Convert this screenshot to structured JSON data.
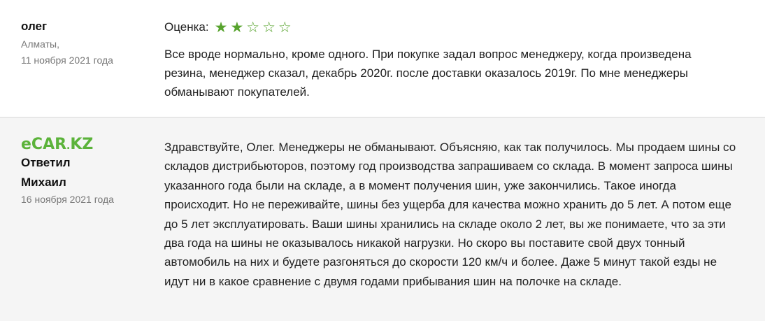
{
  "review": {
    "author": "олег",
    "city": "Алматы,",
    "date": "11 ноября 2021 года",
    "rating_label": "Оценка:",
    "rating": 2,
    "rating_max": 5,
    "star_filled_icon": "star-filled-icon",
    "star_empty_icon": "star-outline-icon",
    "text": "Все вроде нормально, кроме одного. При покупке задал вопрос менеджеру, когда произведена резина, менеджер сказал, декабрь 2020г. после доставки оказалось 2019г. По мне менеджеры обманывают покупателей."
  },
  "reply": {
    "logo_text_main": "eCAR",
    "logo_text_dot": ".",
    "logo_text_tld": "KZ",
    "label": "Ответил",
    "manager": "Михаил",
    "date": "16 ноября 2021 года",
    "text": "Здравствуйте, Олег. Менеджеры не обманывают. Объясняю, как так получилось. Мы продаем шины со складов дистрибьюторов, поэтому год производства запрашиваем со склада. В момент запроса шины указанного года были на складе, а в момент получения шин, уже закончились. Такое иногда происходит. Но не переживайте, шины без ущерба для качества можно хранить до 5 лет. А потом еще до 5 лет эксплуатировать. Ваши шины хранились на складе около 2 лет, вы же понимаете, что за эти два года на шины не оказывалось никакой нагрузки. Но скоро вы поставите свой двух тонный автомобиль на них и будете разгоняться до скорости 120 км/ч и более. Даже 5 минут такой езды не идут ни в какое сравнение с двумя годами прибывания шин на полочке на складе."
  },
  "colors": {
    "accent_green": "#57a32d",
    "logo_green": "#5bb33a",
    "reply_bg": "#f5f5f5",
    "divider": "#d9d9d9"
  }
}
